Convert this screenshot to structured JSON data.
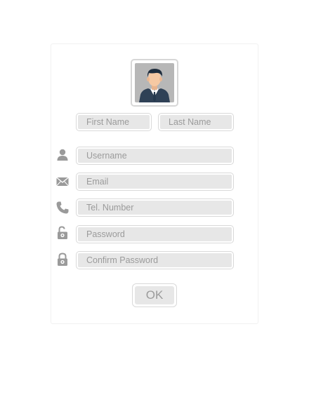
{
  "form": {
    "first_name_placeholder": "First Name",
    "last_name_placeholder": "Last Name",
    "username_placeholder": "Username",
    "email_placeholder": "Email",
    "phone_placeholder": "Tel. Number",
    "password_placeholder": "Password",
    "confirm_password_placeholder": "Confirm Password",
    "ok_label": "OK"
  },
  "icons": {
    "avatar": "user-avatar",
    "username": "user-icon",
    "email": "envelope-icon",
    "phone": "phone-icon",
    "password": "unlocked-padlock-icon",
    "confirm_password": "locked-padlock-icon"
  },
  "colors": {
    "field_fill": "#e7e7e7",
    "field_border": "#d9d9d9",
    "placeholder_text": "#9b9b9b",
    "icon": "#9a9a9a",
    "avatar_background": "#b7b7b7",
    "suit": "#2f4156",
    "hair": "#1f2d3d",
    "skin": "#f6c9a3"
  }
}
